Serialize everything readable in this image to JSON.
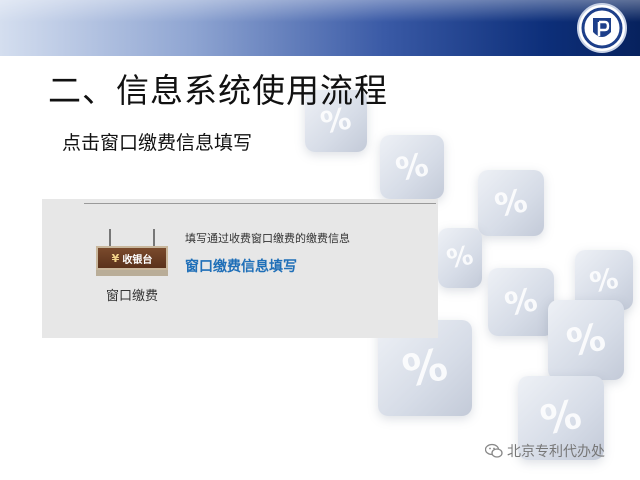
{
  "slide": {
    "title": "二、信息系统使用流程",
    "subtitle": "点击窗口缴费信息填写"
  },
  "panel": {
    "sign_label": "收银台",
    "sign_yen": "¥",
    "icon_caption": "窗口缴费",
    "description": "填写通过收费窗口缴费的缴费信息",
    "link_label": "窗口缴费信息填写"
  },
  "watermark": {
    "text": "北京专利代办处"
  },
  "colors": {
    "banner_dark": "#07225e",
    "link": "#1f6fb8",
    "sign_brown": "#5b321b",
    "panel_bg": "#e7e7e7"
  },
  "icons": {
    "logo": "shield-p-emblem-icon",
    "watermark": "wechat-icon",
    "cashier": "cashier-sign-icon"
  },
  "decor": {
    "cube_glyph": "%"
  }
}
